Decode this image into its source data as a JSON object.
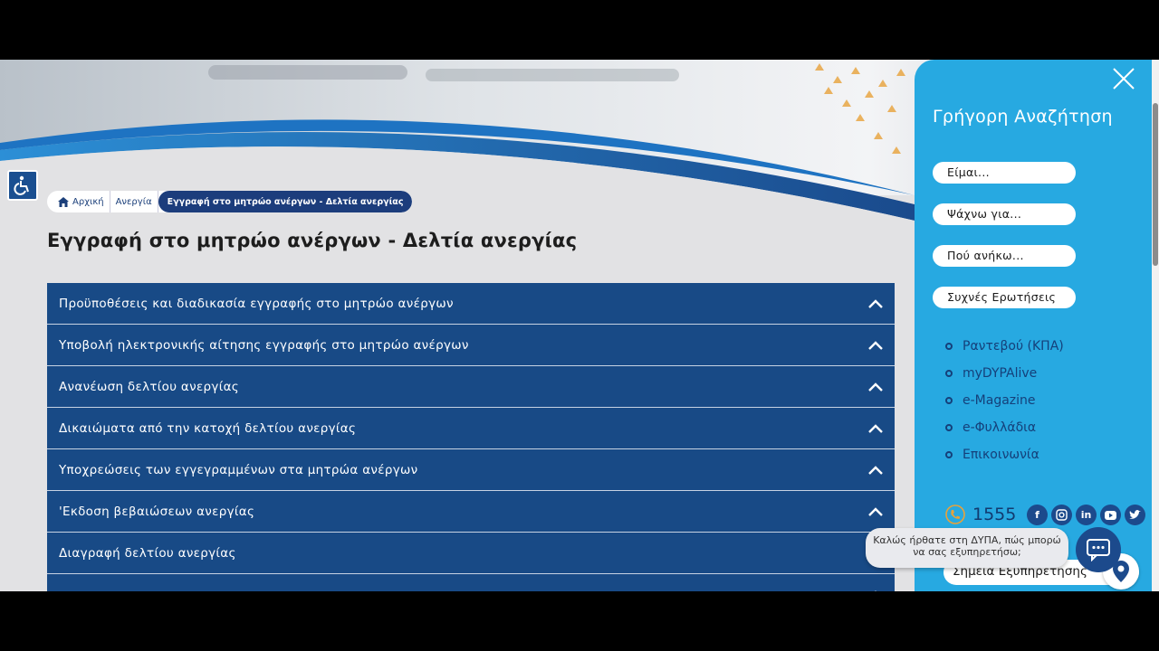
{
  "breadcrumb": {
    "home": "Αρχική",
    "section": "Ανεργία",
    "current": "Εγγραφή στο μητρώο ανέργων - Δελτία ανεργίας"
  },
  "page": {
    "title": "Εγγραφή στο μητρώο ανέργων - Δελτία ανεργίας"
  },
  "accordion": [
    "Προϋποθέσεις και διαδικασία εγγραφής στο μητρώο ανέργων",
    "Υποβολή ηλεκτρονικής αίτησης εγγραφής στο μητρώο ανέργων",
    "Ανανέωση δελτίου ανεργίας",
    "Δικαιώματα από την κατοχή δελτίου ανεργίας",
    "Υποχρεώσεις των εγγεγραμμένων στα μητρώα ανέργων",
    "'Εκδοση βεβαιώσεων ανεργίας",
    "Διαγραφή δελτίου ανεργίας"
  ],
  "panel": {
    "title": "Γρήγορη Αναζήτηση",
    "pills": [
      "Είμαι...",
      "Ψάχνω για...",
      "Πού ανήκω...",
      "Συχνές Ερωτήσεις"
    ],
    "links": [
      "Ραντεβού (ΚΠΑ)",
      "myDYPAlive",
      "e-Magazine",
      "e-Φυλλάδια",
      "Επικοινωνία"
    ],
    "phone": "1555",
    "socials": [
      "facebook-icon",
      "instagram-icon",
      "linkedin-icon",
      "youtube-icon",
      "twitter-icon"
    ],
    "service_points": "Σημεία Εξυπηρέτησης"
  },
  "chat": {
    "greeting": "Καλώς ήρθατε στη ΔΥΠΑ, πώς μπορώ να σας εξυπηρετήσω;"
  },
  "colors": {
    "accordion_bg": "#184a86",
    "panel_bg": "#27a9e1",
    "dark_blue": "#1c3d7c"
  }
}
